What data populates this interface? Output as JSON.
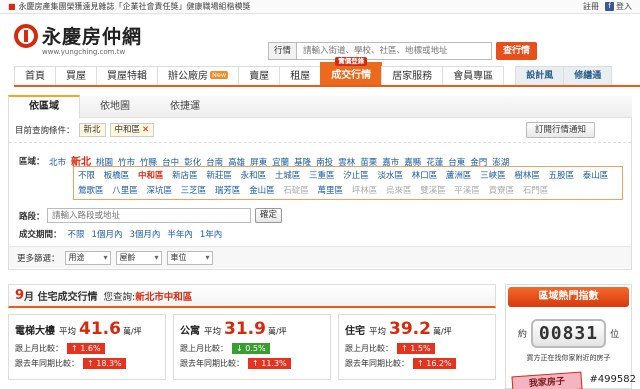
{
  "topbar": {
    "news": "永慶房產集團榮獲遠見雜誌「企業社會責任獎」健康職場組楷模獎",
    "links": [
      {
        "label": "註冊"
      },
      {
        "label": "登入"
      }
    ]
  },
  "brand": {
    "name": "永慶房仲網",
    "url": "www.yungching.com.tw"
  },
  "search": {
    "scope_label": "行情",
    "placeholder": "請輸入街道、學校、社區、地標或地址",
    "button": "查行情"
  },
  "nav": {
    "items": [
      {
        "label": "首頁"
      },
      {
        "label": "買屋"
      },
      {
        "label": "買屋特輯"
      },
      {
        "label": "辦公廠房",
        "tag": "New"
      },
      {
        "label": "賣屋"
      },
      {
        "label": "租屋"
      },
      {
        "label": "成交行情",
        "badge": "實價登錄",
        "active": true
      },
      {
        "label": "居家服務"
      },
      {
        "label": "會員專區"
      }
    ],
    "extra": [
      {
        "label": "設計風"
      },
      {
        "label": "修繕通"
      }
    ]
  },
  "tabs": [
    {
      "label": "依區域",
      "active": true
    },
    {
      "label": "依地圖"
    },
    {
      "label": "依捷運"
    }
  ],
  "conditions": {
    "label": "目前查詢條件：",
    "chips": [
      "新北",
      "中和區"
    ],
    "notify_button": "訂閱行情通知"
  },
  "region": {
    "label": "區域：",
    "cities": [
      "北市",
      "新北",
      "桃園",
      "竹市",
      "竹縣",
      "台中",
      "彰化",
      "台南",
      "高雄",
      "屏東",
      "宜蘭",
      "基隆",
      "南投",
      "雲林",
      "苗栗",
      "嘉市",
      "嘉縣",
      "花蓮",
      "台東",
      "金門",
      "澎湖"
    ],
    "active_city": "新北",
    "districts": [
      "不限",
      "板橋區",
      "中和區",
      "新店區",
      "新莊區",
      "永和區",
      "土城區",
      "三重區",
      "汐止區",
      "淡水區",
      "林口區",
      "蘆洲區",
      "三峽區",
      "樹林區",
      "五股區",
      "泰山區",
      "鶯歌區",
      "八里區",
      "深坑區",
      "三芝區",
      "瑞芳區",
      "金山區",
      "石碇區",
      "萬里區",
      "坪林區",
      "烏來區",
      "雙溪區",
      "平溪區",
      "貢寮區",
      "石門區"
    ],
    "active_district": "中和區",
    "dim_districts": [
      "石碇區",
      "坪林區",
      "烏來區",
      "雙溪區",
      "平溪區",
      "貢寮區",
      "石門區"
    ]
  },
  "road": {
    "label": "路段：",
    "placeholder": "請輸入路段或地址",
    "button": "確定"
  },
  "period": {
    "label": "成交期間：",
    "options": [
      "不限",
      "1個月內",
      "3個月內",
      "半年內",
      "1年內"
    ]
  },
  "more": {
    "label": "更多篩選：",
    "selects": [
      "用途",
      "屋齡",
      "車位"
    ]
  },
  "price_section": {
    "month": "9",
    "title": "月 住宅成交行情",
    "query_label": "您查詢:",
    "query_value": "新北市中和區",
    "avg_label": "平均",
    "unit": "萬/坪",
    "mom_label": "跟上月比較：",
    "yoy_label": "跟去年同期比較：",
    "cards": [
      {
        "type": "電梯大樓",
        "price": "41.6",
        "mom": "↑ 1.6%",
        "mom_dir": "up",
        "yoy": "↑ 18.3%",
        "yoy_dir": "up"
      },
      {
        "type": "公寓",
        "price": "31.9",
        "mom": "↓ 0.5%",
        "mom_dir": "down",
        "yoy": "↑ 11.3%",
        "yoy_dir": "up"
      },
      {
        "type": "住宅",
        "price": "39.2",
        "mom": "↑ 1.5%",
        "mom_dir": "up",
        "yoy": "↑ 16.2%",
        "yoy_dir": "up"
      }
    ]
  },
  "hot": {
    "title": "區域熱門指數",
    "left": "約",
    "value": "00831",
    "right": "位",
    "caption": "買方正在找你家附近的房子",
    "promo": "我家房子"
  },
  "watermark": "#499582",
  "colors": {
    "accent": "#ec6a1d",
    "brand": "#d8290f",
    "link": "#1a5ba6",
    "up": "#e53320",
    "down": "#3a9d30"
  }
}
